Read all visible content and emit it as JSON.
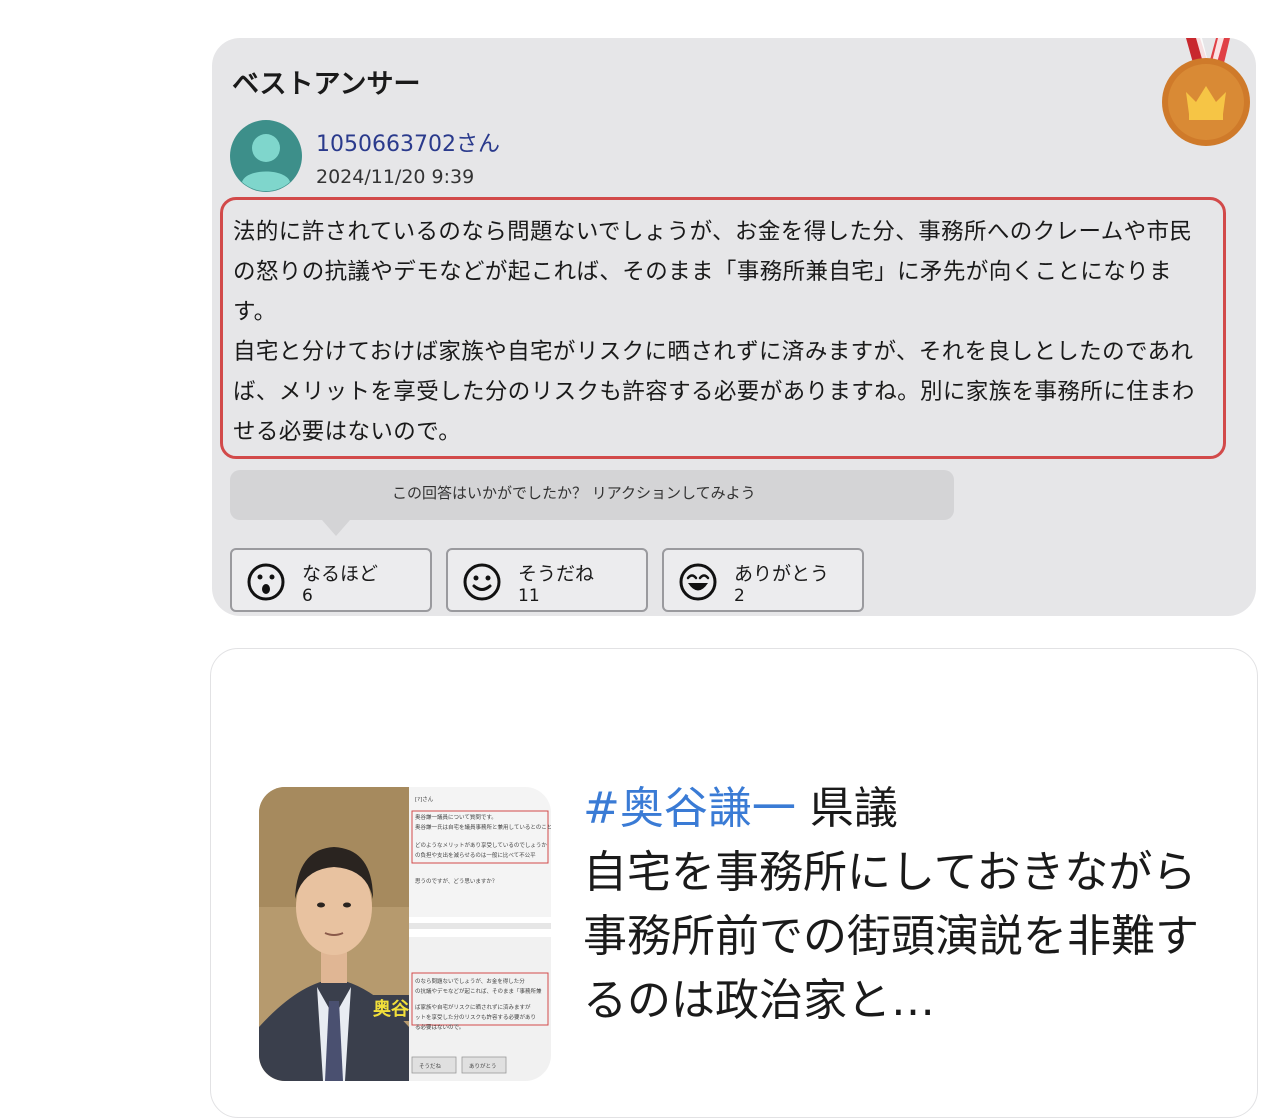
{
  "best_answer": {
    "title": "ベストアンサー",
    "medal_icon": "medal-crown-icon",
    "username": "1050663702さん",
    "datetime": "2024/11/20 9:39",
    "answer_text": "法的に許されているのなら問題ないでしょうが、お金を得した分、事務所へのクレームや市民の怒りの抗議やデモなどが起これば、そのまま「事務所兼自宅」に矛先が向くことになります。\n自宅と分けておけば家族や自宅がリスクに晒されずに済みますが、それを良しとしたのであれば、メリットを享受した分のリスクも許容する必要がありますね。別に家族を事務所に住まわせる必要はないので。",
    "reaction_prompt": "この回答はいかがでしたか？ リアクションしてみよう",
    "reactions": [
      {
        "icon": "surprised-face-icon",
        "label": "なるほど",
        "count": "6"
      },
      {
        "icon": "smile-face-icon",
        "label": "そうだね",
        "count": "11"
      },
      {
        "icon": "grin-face-icon",
        "label": "ありがとう",
        "count": "2"
      }
    ],
    "colors": {
      "highlight_border": "#d24a4a",
      "username": "#2a3a8c"
    }
  },
  "link_preview": {
    "hashtag": "#奥谷謙一",
    "title_rest": " 県議",
    "body": "自宅を事務所にしておきながら事務所前での街頭演説を非難するのは政治家と…",
    "thumbnail_caption": "奥谷",
    "thumbnail_snippets": [
      "[?]さん",
      "奥谷謙一議員について質問です。",
      "奥谷謙一氏は自宅を議員事務所と兼用しているとのこと",
      "どのようなメリットがあり享受しているのでしょうか",
      "の負担や支出を減らせるのは一般に比べて不公平",
      "思うのですが、どう思いますか？",
      "のなら問題ないでしょうが、お金を得した分",
      "の抗議やデモなどが起これば、そのまま「事務所兼",
      "ば家族や自宅がリスクに晒されずに済みますが",
      "ットを享受した分のリスクも許容する必要があり",
      "る必要はないので。",
      "そうだね",
      "ありがとう"
    ],
    "colors": {
      "hashtag": "#3a7bd5"
    }
  }
}
